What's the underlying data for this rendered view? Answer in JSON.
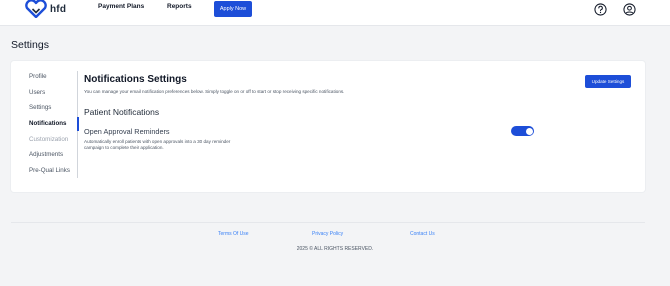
{
  "header": {
    "logo_text": "hfd",
    "nav": {
      "payment_plans": "Payment Plans",
      "reports": "Reports",
      "apply_now": "Apply Now"
    },
    "icons": [
      "help-circle-icon",
      "user-circle-icon"
    ],
    "accent_color": "#1d4ed8"
  },
  "page": {
    "title": "Settings"
  },
  "sidebar": {
    "items": [
      {
        "label": "Profile",
        "state": "normal"
      },
      {
        "label": "Users",
        "state": "normal"
      },
      {
        "label": "Settings",
        "state": "normal"
      },
      {
        "label": "Notifications",
        "state": "active"
      },
      {
        "label": "Customization",
        "state": "disabled"
      },
      {
        "label": "Adjustments",
        "state": "normal"
      },
      {
        "label": "Pre-Qual Links",
        "state": "normal"
      }
    ]
  },
  "content": {
    "title": "Notifications Settings",
    "description": "You can manage your email notification preferences below. Simply toggle on or off to start or stop receiving specific notifications.",
    "update_button": "Update Settings",
    "section_title": "Patient Notifications",
    "reminder": {
      "title": "Open Approval Reminders",
      "description": "Automatically enroll patients with open approvals into a 30 day reminder campaign to complete their application.",
      "enabled": true
    }
  },
  "footer": {
    "links": {
      "terms": "Terms Of Use",
      "privacy": "Privacy Policy",
      "contact": "Contact Us"
    },
    "copyright": "2025 © ALL RIGHTS RESERVED."
  }
}
